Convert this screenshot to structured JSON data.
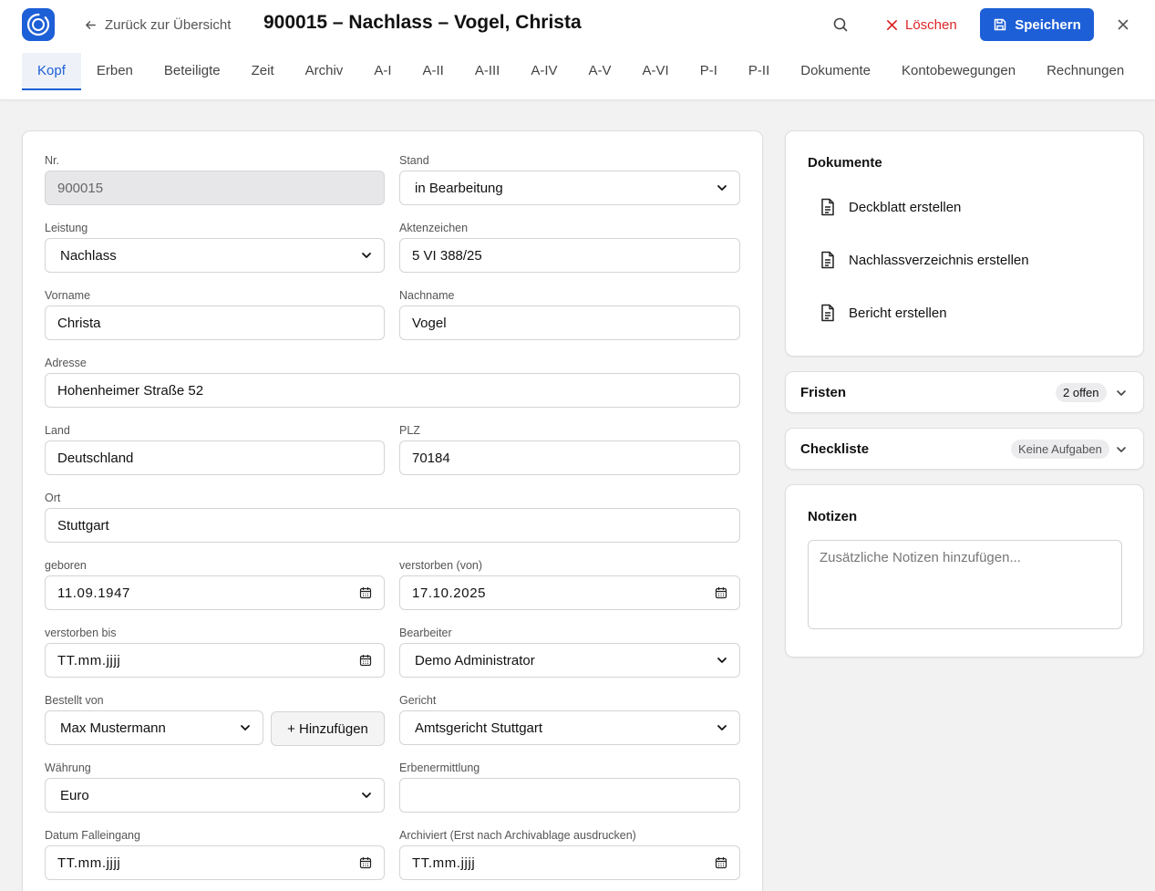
{
  "header": {
    "back_label": "Zurück zur Übersicht",
    "title": "900015 – Nachlass – Vogel, Christa",
    "delete_label": "Löschen",
    "save_label": "Speichern"
  },
  "tabs": [
    {
      "label": "Kopf",
      "active": true
    },
    {
      "label": "Erben"
    },
    {
      "label": "Beteiligte"
    },
    {
      "label": "Zeit"
    },
    {
      "label": "Archiv"
    },
    {
      "label": "A-I"
    },
    {
      "label": "A-II"
    },
    {
      "label": "A-III"
    },
    {
      "label": "A-IV"
    },
    {
      "label": "A-V"
    },
    {
      "label": "A-VI"
    },
    {
      "label": "P-I"
    },
    {
      "label": "P-II"
    },
    {
      "label": "Dokumente"
    },
    {
      "label": "Kontobewegungen"
    },
    {
      "label": "Rechnungen"
    }
  ],
  "form": {
    "nr": {
      "label": "Nr.",
      "value": "900015"
    },
    "stand": {
      "label": "Stand",
      "value": "in Bearbeitung"
    },
    "leistung": {
      "label": "Leistung",
      "value": "Nachlass"
    },
    "aktenzeichen": {
      "label": "Aktenzeichen",
      "value": "5 VI 388/25"
    },
    "vorname": {
      "label": "Vorname",
      "value": "Christa"
    },
    "nachname": {
      "label": "Nachname",
      "value": "Vogel"
    },
    "adresse": {
      "label": "Adresse",
      "value": "Hohenheimer Straße 52"
    },
    "land": {
      "label": "Land",
      "value": "Deutschland"
    },
    "plz": {
      "label": "PLZ",
      "value": "70184"
    },
    "ort": {
      "label": "Ort",
      "value": "Stuttgart"
    },
    "geboren": {
      "label": "geboren",
      "value": "11.09.1947"
    },
    "verstorben_von": {
      "label": "verstorben (von)",
      "value": "17.10.2025"
    },
    "verstorben_bis": {
      "label": "verstorben bis",
      "value": "TT.mm.jjjj"
    },
    "bearbeiter": {
      "label": "Bearbeiter",
      "value": "Demo Administrator"
    },
    "bestellt_von": {
      "label": "Bestellt von",
      "value": "Max Mustermann",
      "add_label": "+ Hinzufügen"
    },
    "gericht": {
      "label": "Gericht",
      "value": "Amtsgericht Stuttgart"
    },
    "waehrung": {
      "label": "Währung",
      "value": "Euro"
    },
    "erbenermittlung": {
      "label": "Erbenermittlung",
      "value": ""
    },
    "datum_falleingang": {
      "label": "Datum Falleingang",
      "value": "TT.mm.jjjj"
    },
    "archiviert": {
      "label": "Archiviert (Erst nach Archivablage ausdrucken)",
      "value": "TT.mm.jjjj"
    }
  },
  "documents": {
    "title": "Dokumente",
    "items": [
      "Deckblatt erstellen",
      "Nachlassverzeichnis erstellen",
      "Bericht erstellen"
    ]
  },
  "fristen": {
    "title": "Fristen",
    "badge": "2 offen"
  },
  "checkliste": {
    "title": "Checkliste",
    "badge": "Keine Aufgaben"
  },
  "notizen": {
    "title": "Notizen",
    "placeholder": "Zusätzliche Notizen hinzufügen..."
  },
  "colors": {
    "primary": "#1d5fd6",
    "danger": "#dc2626"
  },
  "icons": {
    "logo": "app-logo-icon",
    "back": "arrow-left-icon",
    "search": "search-icon",
    "delete": "x-icon",
    "save": "floppy-disk-icon",
    "close": "close-icon",
    "document": "document-icon",
    "calendar": "calendar-icon",
    "chevron": "chevron-down-icon"
  }
}
